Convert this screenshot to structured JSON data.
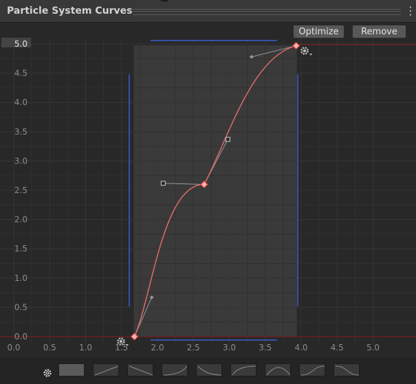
{
  "window": {
    "title": "Particle System Curves"
  },
  "toolbar": {
    "optimize_label": "Optimize",
    "remove_label": "Remove"
  },
  "chart_data": {
    "type": "line",
    "x_ticks": [
      "0.0",
      "0.5",
      "1.0",
      "1.5",
      "2.0",
      "2.5",
      "3.0",
      "3.5",
      "4.0",
      "4.5",
      "5.0"
    ],
    "y_ticks": [
      "0.0",
      "0.5",
      "1.0",
      "1.5",
      "2.0",
      "2.5",
      "3.0",
      "3.5",
      "4.0",
      "4.5",
      "5.0"
    ],
    "xlim": [
      0,
      5.0
    ],
    "ylim": [
      0,
      5.0
    ],
    "grid": true,
    "selected_range": {
      "x": [
        1.68,
        3.93
      ]
    },
    "keys": [
      {
        "x": 1.68,
        "y": 0.0
      },
      {
        "x": 2.65,
        "y": 2.6
      },
      {
        "x": 3.93,
        "y": 4.97
      }
    ],
    "tangent_handles": [
      {
        "x": 1.92,
        "y": 0.67
      },
      {
        "x": 2.08,
        "y": 2.62
      },
      {
        "x": 2.98,
        "y": 3.37
      },
      {
        "x": 3.31,
        "y": 4.78
      }
    ],
    "curve_color": "#e06a6a",
    "boundary_color": "#8a1a1a"
  },
  "presets": {
    "items": [
      "constant",
      "linear-up",
      "linear-down",
      "ease-in",
      "ease-out-down",
      "ease-out",
      "bell",
      "ease-in-out",
      "ease-in-out-down"
    ]
  }
}
